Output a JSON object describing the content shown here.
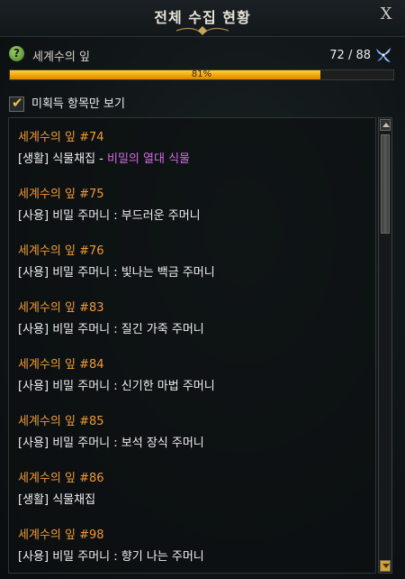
{
  "window": {
    "title": "전체 수집 현황",
    "close_label": "X"
  },
  "header": {
    "help_label": "?",
    "category": "세계수의 잎",
    "count": "72 / 88",
    "icon": "leaf-icon"
  },
  "progress": {
    "fraction": 0.81,
    "label": "81%"
  },
  "filter": {
    "label": "미획득 항목만 보기",
    "checked": true
  },
  "items": [
    {
      "title": "세계수의 잎 #74",
      "desc": "[생활] 식물채집 - ",
      "highlight": "비밀의 열대 식물"
    },
    {
      "title": "세계수의 잎 #75",
      "desc": "[사용] 비밀 주머니 : 부드러운 주머니",
      "highlight": ""
    },
    {
      "title": "세계수의 잎 #76",
      "desc": "[사용] 비밀 주머니 : 빛나는 백금 주머니",
      "highlight": ""
    },
    {
      "title": "세계수의 잎 #83",
      "desc": "[사용] 비밀 주머니 : 질긴 가죽 주머니",
      "highlight": ""
    },
    {
      "title": "세계수의 잎 #84",
      "desc": "[사용] 비밀 주머니 : 신기한 마법 주머니",
      "highlight": ""
    },
    {
      "title": "세계수의 잎 #85",
      "desc": "[사용] 비밀 주머니 : 보석 장식 주머니",
      "highlight": ""
    },
    {
      "title": "세계수의 잎 #86",
      "desc": "[생활] 식물채집",
      "highlight": ""
    },
    {
      "title": "세계수의 잎 #98",
      "desc": "[사용] 비밀 주머니 : 향기 나는 주머니",
      "highlight": ""
    }
  ],
  "colors": {
    "item_title": "#f19a37",
    "highlight": "#d46ae6",
    "progress": "#f2a10a"
  }
}
